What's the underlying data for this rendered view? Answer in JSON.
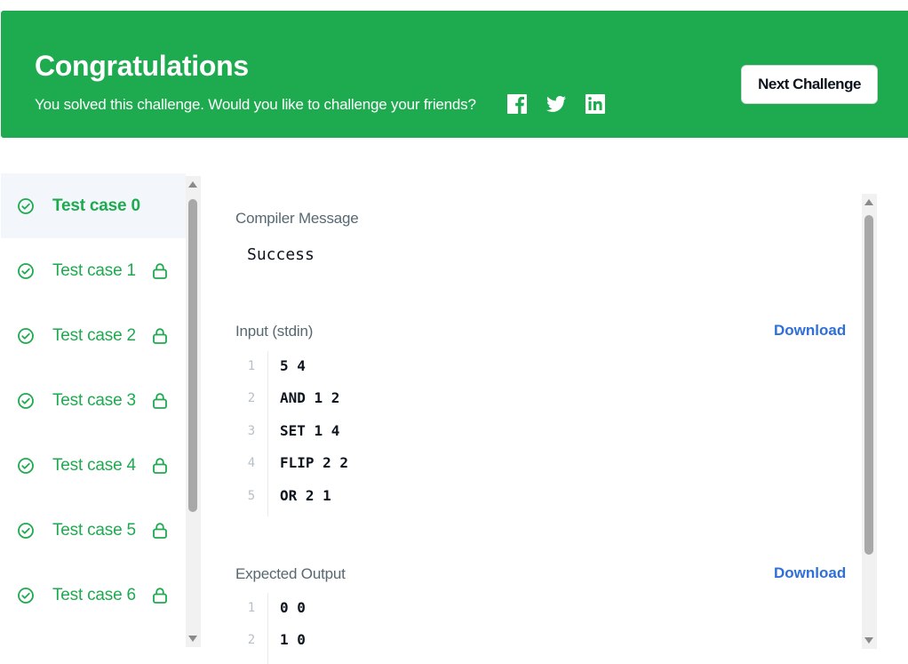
{
  "banner": {
    "title": "Congratulations",
    "subtitle": "You solved this challenge. Would you like to challenge your friends?",
    "social": [
      "facebook-icon",
      "twitter-icon",
      "linkedin-icon"
    ],
    "next_button": "Next Challenge",
    "color": "#1eaa4f"
  },
  "test_cases": [
    {
      "label": "Test case 0",
      "active": true,
      "locked": false
    },
    {
      "label": "Test case 1",
      "active": false,
      "locked": true
    },
    {
      "label": "Test case 2",
      "active": false,
      "locked": true
    },
    {
      "label": "Test case 3",
      "active": false,
      "locked": true
    },
    {
      "label": "Test case 4",
      "active": false,
      "locked": true
    },
    {
      "label": "Test case 5",
      "active": false,
      "locked": true
    },
    {
      "label": "Test case 6",
      "active": false,
      "locked": true
    }
  ],
  "compiler": {
    "label": "Compiler Message",
    "message": "Success"
  },
  "input": {
    "label": "Input (stdin)",
    "download": "Download",
    "lines": [
      "5 4",
      "AND 1 2",
      "SET 1 4",
      "FLIP 2 2",
      "OR 2 1"
    ]
  },
  "expected": {
    "label": "Expected Output",
    "download": "Download",
    "lines": [
      "0 0",
      "1 0"
    ]
  },
  "colors": {
    "accent_green": "#1eaa4f",
    "link_blue": "#2f6fd9"
  }
}
